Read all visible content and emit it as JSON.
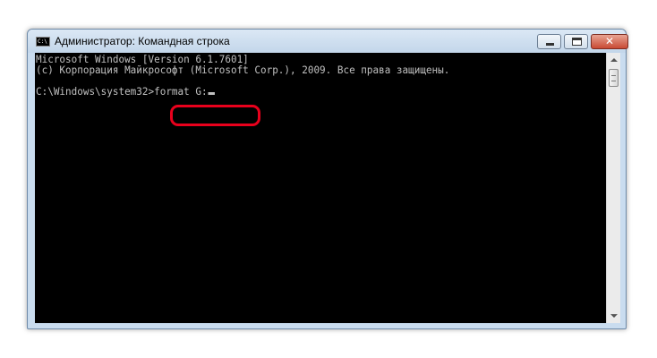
{
  "window": {
    "title": "Администратор: Командная строка",
    "icon_text": "C:\\",
    "close_glyph": "✕"
  },
  "console": {
    "line1": "Microsoft Windows [Version 6.1.7601]",
    "line2": "(c) Корпорация Майкрософт (Microsoft Corp.), 2009. Все права защищены.",
    "prompt": "C:\\Windows\\system32>",
    "command": "format G:"
  },
  "icons": {
    "app": "console-app-icon",
    "minimize": "minimize-icon",
    "maximize": "maximize-icon",
    "close": "close-icon"
  },
  "colors": {
    "console_background": "#000000",
    "console_text": "#c0c0c0",
    "highlight": "#e8001c",
    "close_button": "#c94a34"
  }
}
